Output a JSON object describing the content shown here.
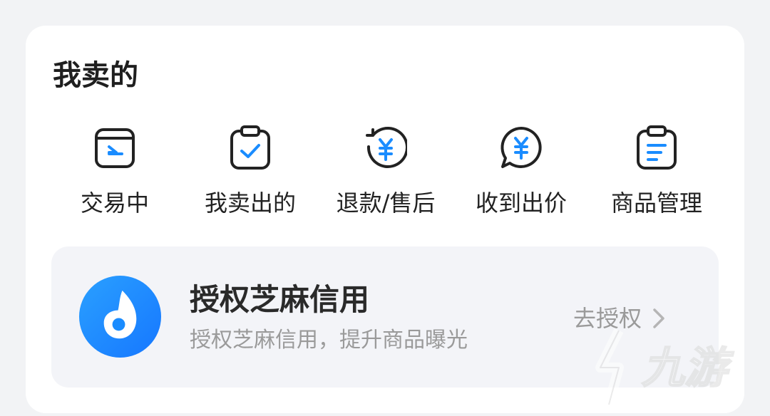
{
  "section": {
    "title": "我卖的"
  },
  "shortcuts": [
    {
      "label": "交易中",
      "icon": "trading-wallet-icon"
    },
    {
      "label": "我卖出的",
      "icon": "sold-clipboard-check-icon"
    },
    {
      "label": "退款/售后",
      "icon": "refund-yuan-cycle-icon"
    },
    {
      "label": "收到出价",
      "icon": "offer-yuan-chat-icon"
    },
    {
      "label": "商品管理",
      "icon": "goods-manage-clipboard-icon"
    }
  ],
  "banner": {
    "title": "授权芝麻信用",
    "subtitle": "授权芝麻信用，提升商品曝光",
    "action": "去授权",
    "logo_icon": "sesame-credit-logo-icon"
  },
  "watermark": {
    "text": "九游"
  },
  "colors": {
    "background": "#f2f3f5",
    "card": "#ffffff",
    "banner": "#f3f4f8",
    "accent": "#1a8cff",
    "icon_stroke": "#222222"
  }
}
